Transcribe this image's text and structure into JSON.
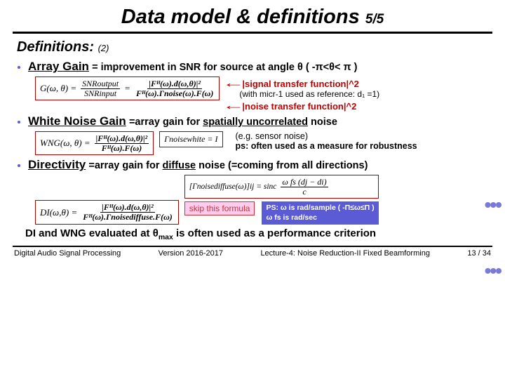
{
  "title": "Data model & definitions",
  "title_part": "5/5",
  "section": "Definitions:",
  "section_sub": "(2)",
  "items": {
    "array_gain": {
      "term": "Array Gain",
      "desc_prefix": " = improvement in SNR for source at angle θ   ( -π<θ< π )",
      "formula_lhs": "G(ω, θ) =",
      "formula_frac_num": "SNRoutput",
      "formula_frac_den": "SNRinput",
      "formula_rhs_num": "|Fᴴ(ω).d(ω,θ)|²",
      "formula_rhs_den": "Fᴴ(ω).Γnoise(ω).F(ω)",
      "annot1": "|signal transfer function|^2",
      "annot_mid": "(with micr-1 used as reference: d₁ =1)",
      "annot2": "|noise transfer function|^2"
    },
    "wng": {
      "term": "White Noise Gain",
      "desc": " =array gain for ",
      "desc_und": "spatially uncorrelated",
      "desc_tail": " noise",
      "formula_lhs": "WNG(ω, θ) =",
      "formula_rhs_num": "|Fᴴ(ω).d(ω,θ)|²",
      "formula_rhs_den": "Fᴴ(ω).F(ω)",
      "gamma_box": "Γnoisewhite = I",
      "note1": "(e.g. sensor noise)",
      "note2": "ps: often used as a measure for robustness"
    },
    "directivity": {
      "term": "Directivity",
      "desc": " =array gain for ",
      "desc_und": "diffuse",
      "desc_tail": " noise (=coming from all directions)",
      "formula_lhs": "DI(ω,θ) =",
      "formula_rhs_num": "|Fᴴ(ω).d(ω,θ)|²",
      "formula_rhs_den": "Fᴴ(ω).Γnoisediffuse.F(ω)",
      "gamma_lhs": "[Γnoisediffuse(ω)]ij = sinc",
      "gamma_frac_num": "ω fs (dj − di)",
      "gamma_frac_den": "c",
      "skip_label": "skip this formula",
      "ps_line1": "PS: ω is rad/sample ( -Π≤ω≤Π )",
      "ps_line2": "ω fs is rad/sec"
    }
  },
  "closing": "DI and WNG evaluated at θmax is often used as a performance criterion",
  "footer": {
    "left": "Digital Audio Signal Processing",
    "mid": "Version 2016-2017",
    "right": "Lecture-4: Noise Reduction-II Fixed Beamforming",
    "page": "13 / 34"
  }
}
